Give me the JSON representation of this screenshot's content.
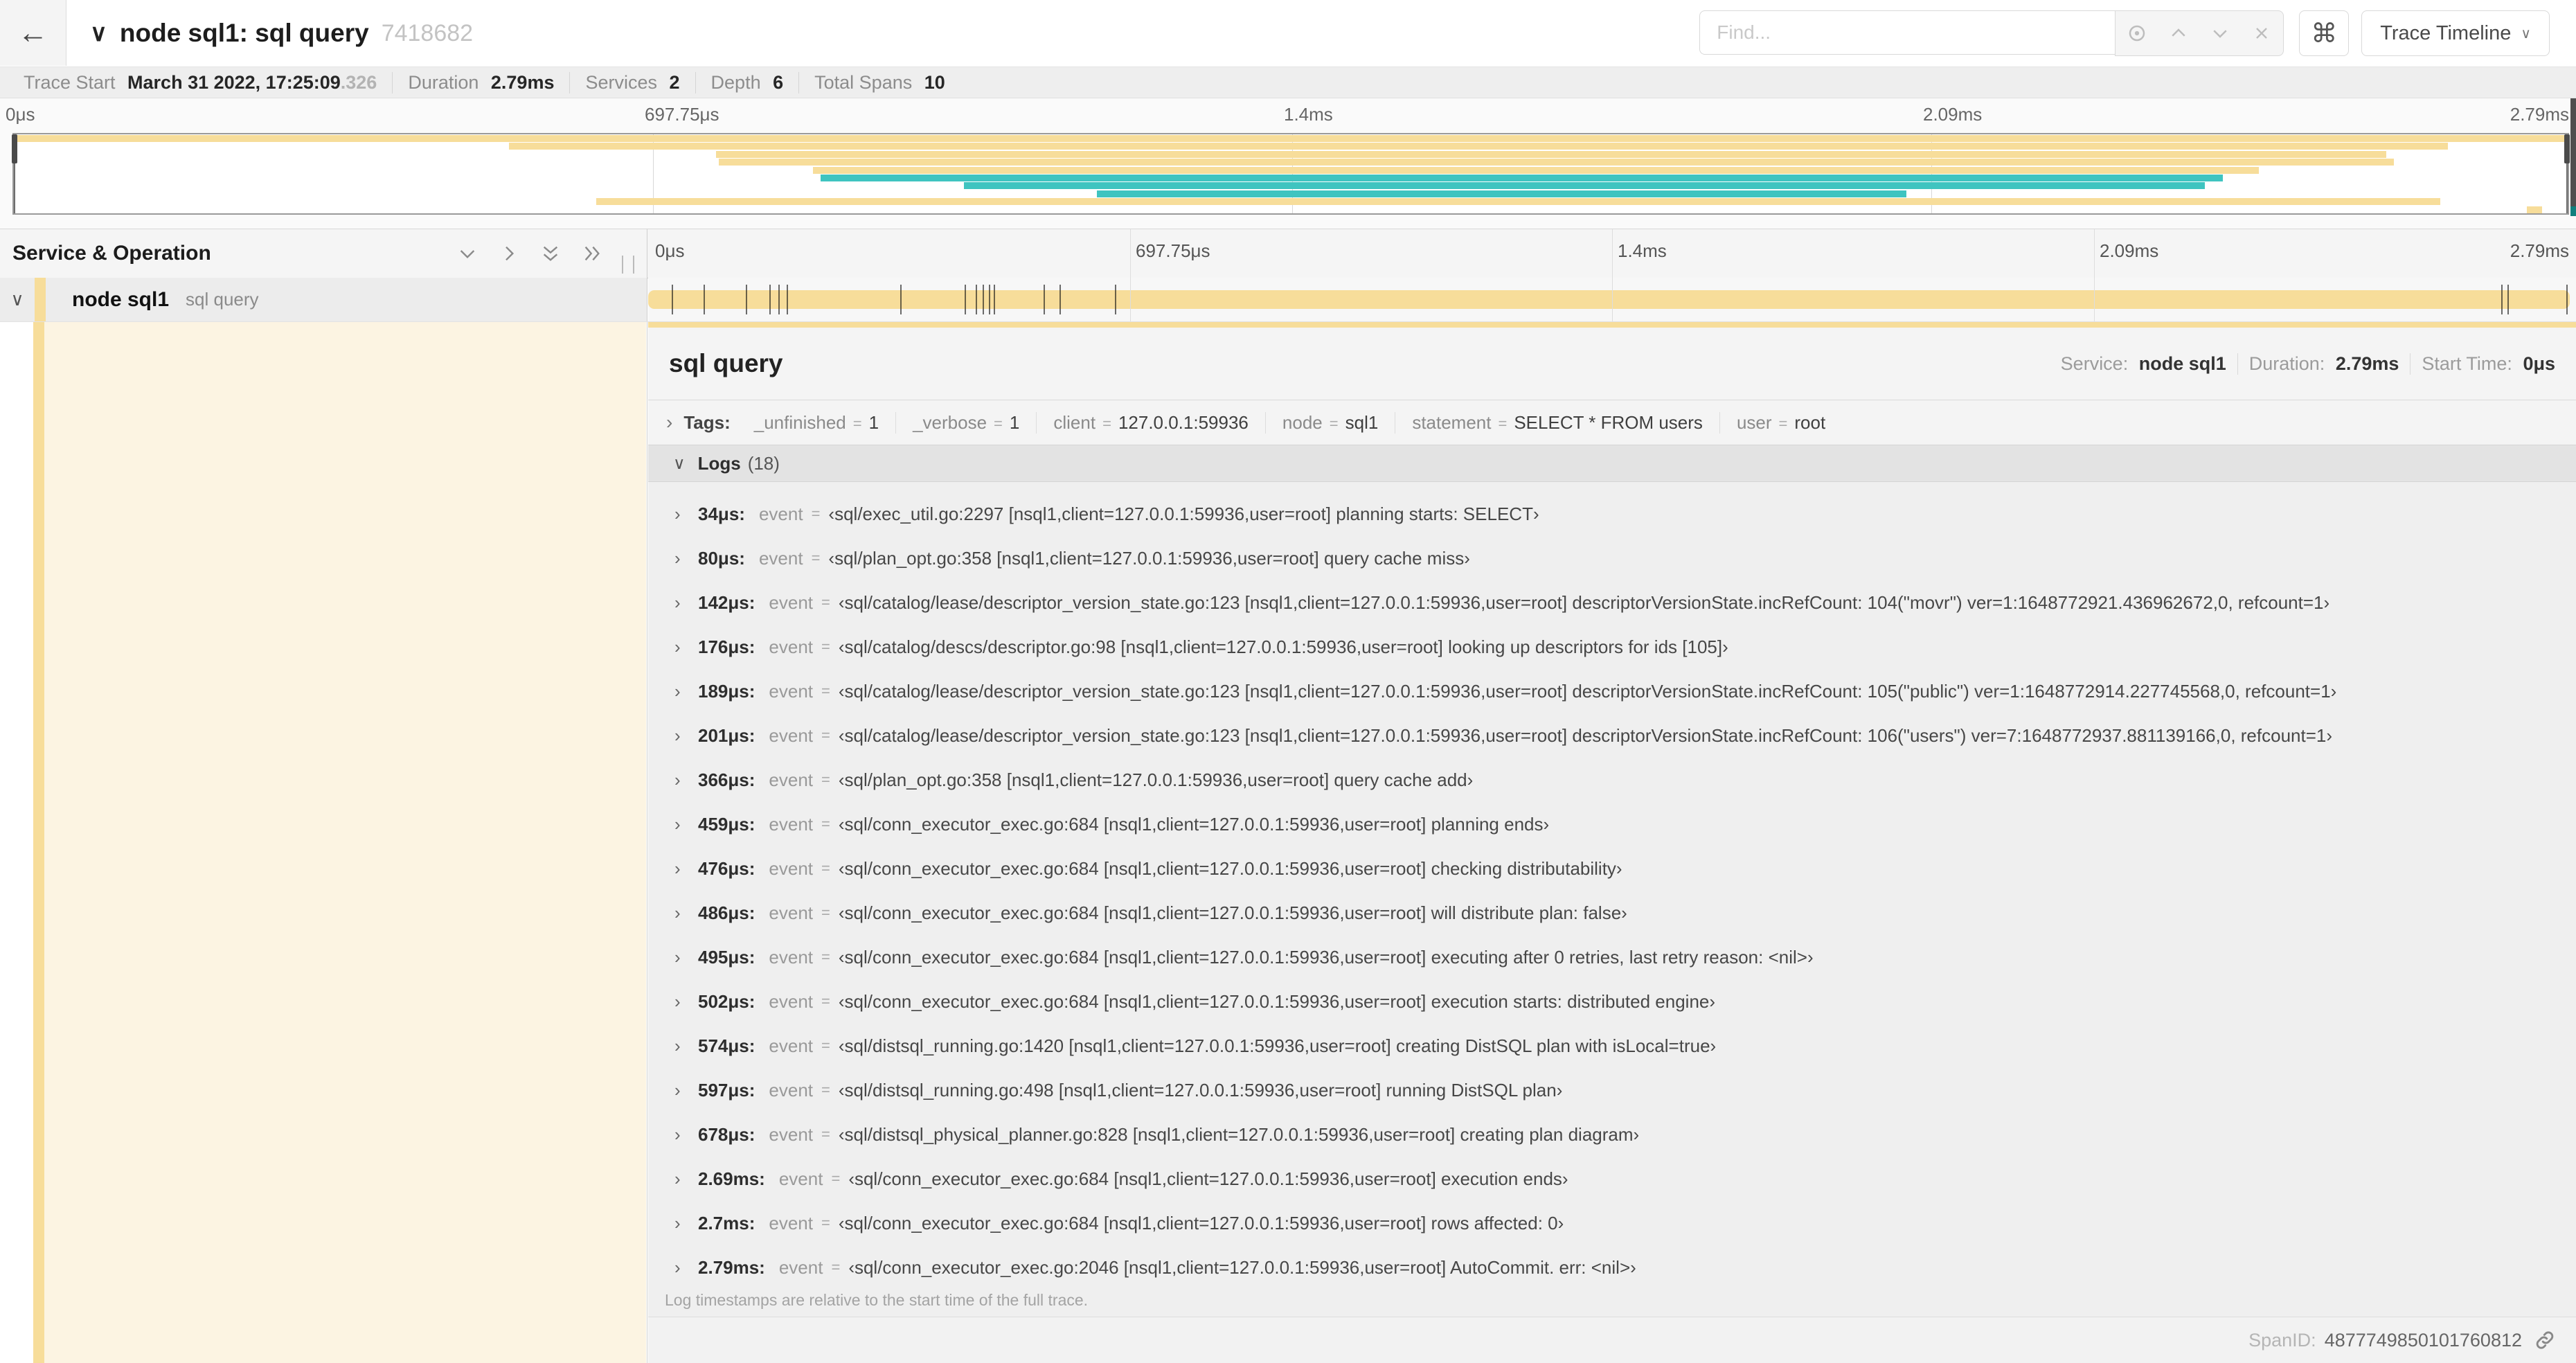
{
  "header": {
    "back_icon": "←",
    "collapse_icon": "∨",
    "title": "node sql1: sql query",
    "trace_id_short": "7418682",
    "find_placeholder": "Find...",
    "shortcut_button": "⌘",
    "view_selector": "Trace Timeline",
    "view_selector_chevron": "∨"
  },
  "summary": {
    "items": [
      {
        "label": "Trace Start",
        "value": "March 31 2022, 17:25:09",
        "suffix": ".326"
      },
      {
        "label": "Duration",
        "value": "2.79ms"
      },
      {
        "label": "Services",
        "value": "2"
      },
      {
        "label": "Depth",
        "value": "6"
      },
      {
        "label": "Total Spans",
        "value": "10"
      }
    ]
  },
  "timeline": {
    "ticks": [
      "0μs",
      "697.75μs",
      "1.4ms",
      "2.09ms",
      "2.79ms"
    ],
    "tick_positions": [
      0,
      25,
      50,
      75,
      100
    ],
    "duration_us": 2790
  },
  "minimap": {
    "colors": {
      "tan": "#F7DD9A",
      "teal": "#3FC4C0"
    },
    "spans": [
      {
        "start": 0.0,
        "end": 1.0,
        "color": "tan"
      },
      {
        "start": 0.194,
        "end": 0.953,
        "color": "tan"
      },
      {
        "start": 0.275,
        "end": 0.929,
        "color": "tan"
      },
      {
        "start": 0.276,
        "end": 0.932,
        "color": "tan"
      },
      {
        "start": 0.313,
        "end": 0.879,
        "color": "tan"
      },
      {
        "start": 0.316,
        "end": 0.865,
        "color": "teal"
      },
      {
        "start": 0.372,
        "end": 0.858,
        "color": "teal"
      },
      {
        "start": 0.424,
        "end": 0.741,
        "color": "teal"
      },
      {
        "start": 0.228,
        "end": 0.95,
        "color": "tan"
      },
      {
        "start": 0.984,
        "end": 0.99,
        "color": "tan"
      }
    ]
  },
  "grid_header": {
    "left_title": "Service & Operation"
  },
  "span_row": {
    "collapse_icon": "∨",
    "service": "node sql1",
    "operation": "sql query"
  },
  "detail": {
    "title": "sql query",
    "meta": [
      {
        "label": "Service:",
        "value": "node sql1"
      },
      {
        "label": "Duration:",
        "value": "2.79ms"
      },
      {
        "label": "Start Time:",
        "value": "0μs"
      }
    ],
    "tags": {
      "chevron": "›",
      "label": "Tags:",
      "items": [
        {
          "key": "_unfinished",
          "value": "1"
        },
        {
          "key": "_verbose",
          "value": "1"
        },
        {
          "key": "client",
          "value": "127.0.0.1:59936"
        },
        {
          "key": "node",
          "value": "sql1"
        },
        {
          "key": "statement",
          "value": "SELECT * FROM users"
        },
        {
          "key": "user",
          "value": "root"
        }
      ]
    },
    "logs": {
      "chevron": "∨",
      "label": "Logs",
      "count": "(18)",
      "row_chevron": "›",
      "key": "event",
      "entries": [
        {
          "time": "34μs:",
          "t_us": 34,
          "value": "sql/exec_util.go:2297 [nsql1,client=127.0.0.1:59936,user=root] planning starts: SELECT"
        },
        {
          "time": "80μs:",
          "t_us": 80,
          "value": "sql/plan_opt.go:358 [nsql1,client=127.0.0.1:59936,user=root] query cache miss"
        },
        {
          "time": "142μs:",
          "t_us": 142,
          "value": "sql/catalog/lease/descriptor_version_state.go:123 [nsql1,client=127.0.0.1:59936,user=root] descriptorVersionState.incRefCount: 104(\"movr\") ver=1:1648772921.436962672,0, refcount=1"
        },
        {
          "time": "176μs:",
          "t_us": 176,
          "value": "sql/catalog/descs/descriptor.go:98 [nsql1,client=127.0.0.1:59936,user=root] looking up descriptors for ids [105]"
        },
        {
          "time": "189μs:",
          "t_us": 189,
          "value": "sql/catalog/lease/descriptor_version_state.go:123 [nsql1,client=127.0.0.1:59936,user=root] descriptorVersionState.incRefCount: 105(\"public\") ver=1:1648772914.227745568,0, refcount=1"
        },
        {
          "time": "201μs:",
          "t_us": 201,
          "value": "sql/catalog/lease/descriptor_version_state.go:123 [nsql1,client=127.0.0.1:59936,user=root] descriptorVersionState.incRefCount: 106(\"users\") ver=7:1648772937.881139166,0, refcount=1"
        },
        {
          "time": "366μs:",
          "t_us": 366,
          "value": "sql/plan_opt.go:358 [nsql1,client=127.0.0.1:59936,user=root] query cache add"
        },
        {
          "time": "459μs:",
          "t_us": 459,
          "value": "sql/conn_executor_exec.go:684 [nsql1,client=127.0.0.1:59936,user=root] planning ends"
        },
        {
          "time": "476μs:",
          "t_us": 476,
          "value": "sql/conn_executor_exec.go:684 [nsql1,client=127.0.0.1:59936,user=root] checking distributability"
        },
        {
          "time": "486μs:",
          "t_us": 486,
          "value": "sql/conn_executor_exec.go:684 [nsql1,client=127.0.0.1:59936,user=root] will distribute plan: false"
        },
        {
          "time": "495μs:",
          "t_us": 495,
          "value": "sql/conn_executor_exec.go:684 [nsql1,client=127.0.0.1:59936,user=root] executing after 0 retries, last retry reason: <nil>"
        },
        {
          "time": "502μs:",
          "t_us": 502,
          "value": "sql/conn_executor_exec.go:684 [nsql1,client=127.0.0.1:59936,user=root] execution starts: distributed engine"
        },
        {
          "time": "574μs:",
          "t_us": 574,
          "value": "sql/distsql_running.go:1420 [nsql1,client=127.0.0.1:59936,user=root] creating DistSQL plan with isLocal=true"
        },
        {
          "time": "597μs:",
          "t_us": 597,
          "value": "sql/distsql_running.go:498 [nsql1,client=127.0.0.1:59936,user=root] running DistSQL plan"
        },
        {
          "time": "678μs:",
          "t_us": 678,
          "value": "sql/distsql_physical_planner.go:828 [nsql1,client=127.0.0.1:59936,user=root] creating plan diagram"
        },
        {
          "time": "2.69ms:",
          "t_us": 2690,
          "value": "sql/conn_executor_exec.go:684 [nsql1,client=127.0.0.1:59936,user=root] execution ends"
        },
        {
          "time": "2.7ms:",
          "t_us": 2700,
          "value": "sql/conn_executor_exec.go:684 [nsql1,client=127.0.0.1:59936,user=root] rows affected: 0"
        },
        {
          "time": "2.79ms:",
          "t_us": 2790,
          "value": "sql/conn_executor_exec.go:2046 [nsql1,client=127.0.0.1:59936,user=root] AutoCommit. err: <nil>"
        }
      ],
      "note": "Log timestamps are relative to the start time of the full trace."
    },
    "footer": {
      "label": "SpanID:",
      "value": "4877749850101760812"
    }
  }
}
